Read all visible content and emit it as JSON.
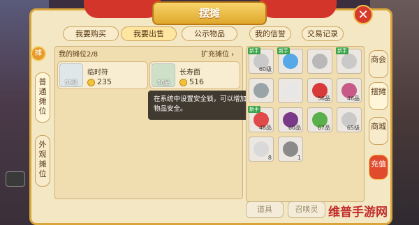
{
  "header": {
    "title": "摆摊",
    "close_symbol": "✕"
  },
  "tabs": [
    {
      "label": "我要购买"
    },
    {
      "label": "我要出售"
    },
    {
      "label": "公示物品"
    },
    {
      "label": "我的信誉"
    },
    {
      "label": "交易记录"
    }
  ],
  "left_tabs": [
    {
      "label": "普通摊位",
      "active": true
    },
    {
      "label": "外观摊位",
      "active": false
    }
  ],
  "stall": {
    "title": "我的摊位2/8",
    "expand": "扩充摊位 ›",
    "marker": "摊"
  },
  "items": [
    {
      "name": "临时符",
      "level": "59级",
      "price": "235"
    },
    {
      "name": "长寿面",
      "level": "56品",
      "price": "516"
    }
  ],
  "tooltip": "在系统中设置安全锁，可以增加物品安全。",
  "inventory": [
    {
      "qty": "60级",
      "new": "新手",
      "color": "#c9c9c9"
    },
    {
      "qty": "",
      "new": "新手",
      "color": "#58a8e8"
    },
    {
      "qty": "",
      "new": "",
      "color": "#b8b8b8"
    },
    {
      "qty": "",
      "new": "新手",
      "color": "#c9c9c9"
    },
    {
      "qty": "",
      "new": "",
      "color": "#9aa4a8"
    },
    {
      "qty": "",
      "new": "",
      "color": "#e7e7e7"
    },
    {
      "qty": "56品",
      "new": "",
      "color": "#d83a3a"
    },
    {
      "qty": "46品",
      "new": "",
      "color": "#c85a8a"
    },
    {
      "qty": "48品",
      "new": "新手",
      "color": "#e04a4a"
    },
    {
      "qty": "60品",
      "new": "",
      "color": "#7a3a8a"
    },
    {
      "qty": "67品",
      "new": "",
      "color": "#5ab04a"
    },
    {
      "qty": "65级",
      "new": "",
      "color": "#c9c9c9"
    },
    {
      "qty": "8",
      "new": "",
      "color": "#d9d9d9"
    },
    {
      "qty": "1",
      "new": "",
      "color": "#8a8a8a"
    }
  ],
  "side_tabs": [
    {
      "label": "商会"
    },
    {
      "label": "摆摊",
      "active": true
    },
    {
      "label": "商城"
    },
    {
      "label": "充值"
    }
  ],
  "bottom": [
    {
      "label": "道具"
    },
    {
      "label": "召唤灵"
    }
  ],
  "watermark": "维普手游网"
}
